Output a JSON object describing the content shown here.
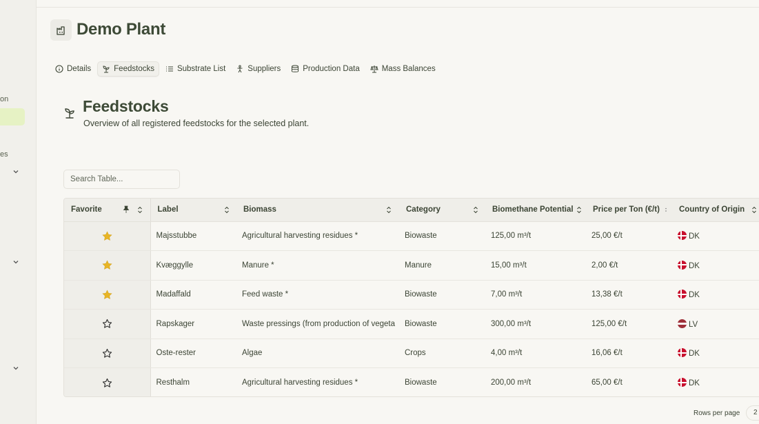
{
  "sidebar": {
    "partial_labels": [
      "on",
      "es"
    ]
  },
  "plant": {
    "title": "Demo Plant",
    "icon": "factory-icon"
  },
  "tabs": [
    {
      "label": "Details",
      "icon": "info-icon",
      "active": false
    },
    {
      "label": "Feedstocks",
      "icon": "sprout-icon",
      "active": true
    },
    {
      "label": "Substrate List",
      "icon": "list-icon",
      "active": false
    },
    {
      "label": "Suppliers",
      "icon": "person-icon",
      "active": false
    },
    {
      "label": "Production Data",
      "icon": "database-icon",
      "active": false
    },
    {
      "label": "Mass Balances",
      "icon": "scale-icon",
      "active": false
    }
  ],
  "section": {
    "title": "Feedstocks",
    "subtitle": "Overview of all registered feedstocks for the selected plant.",
    "icon": "sprout-icon"
  },
  "search": {
    "placeholder": "Search Table...",
    "value": ""
  },
  "table": {
    "columns": [
      "Favorite",
      "Label",
      "Biomass",
      "Category",
      "Biomethane Potential",
      "Price per Ton (€/t)",
      "Country of Origin"
    ],
    "rows": [
      {
        "favorite": true,
        "label": "Majsstubbe",
        "biomass": "Agricultural harvesting residues *",
        "category": "Biowaste",
        "potential": "125,00 m³/t",
        "price": "25,00 €/t",
        "country": "DK"
      },
      {
        "favorite": true,
        "label": "Kvæggylle",
        "biomass": "Manure *",
        "category": "Manure",
        "potential": "15,00 m³/t",
        "price": "2,00 €/t",
        "country": "DK"
      },
      {
        "favorite": true,
        "label": "Madaffald",
        "biomass": "Feed waste *",
        "category": "Biowaste",
        "potential": "7,00 m³/t",
        "price": "13,38 €/t",
        "country": "DK"
      },
      {
        "favorite": false,
        "label": "Rapskager",
        "biomass": "Waste pressings (from production of vegeta",
        "category": "Biowaste",
        "potential": "300,00 m³/t",
        "price": "125,00 €/t",
        "country": "LV"
      },
      {
        "favorite": false,
        "label": "Oste-rester",
        "biomass": "Algae",
        "category": "Crops",
        "potential": "4,00 m³/t",
        "price": "16,06 €/t",
        "country": "DK"
      },
      {
        "favorite": false,
        "label": "Resthalm",
        "biomass": "Agricultural harvesting residues *",
        "category": "Biowaste",
        "potential": "200,00 m³/t",
        "price": "65,00 €/t",
        "country": "DK"
      }
    ]
  },
  "pagination": {
    "rows_per_page_label": "Rows per page",
    "rows_per_page_value": "2"
  },
  "colors": {
    "star_filled": "#e8b526",
    "active_nav": "#e6f2c4",
    "heading": "#3d4a36"
  }
}
